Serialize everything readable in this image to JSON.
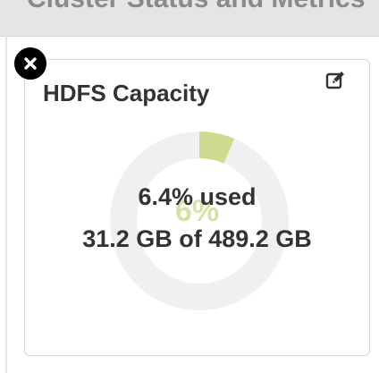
{
  "section": {
    "title": "Cluster Status and Metrics"
  },
  "widget": {
    "title": "HDFS Capacity",
    "used_label": "6.4% used",
    "capacity_label": "31.2 GB of 489.2 GB",
    "chart_percent_label": "6%",
    "used_fraction": 0.064,
    "colors": {
      "used": "#cfdc8f",
      "track": "#f0f0f0",
      "text": "#333333"
    }
  },
  "icons": {
    "edit": "edit-icon",
    "remove": "close-icon"
  }
}
